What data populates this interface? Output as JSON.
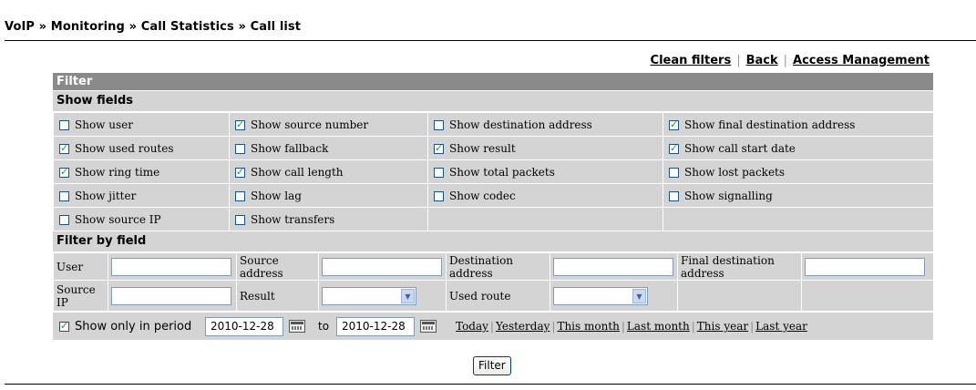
{
  "breadcrumb": "VoIP » Monitoring » Call Statistics » Call list",
  "top_links": [
    "Clean filters",
    "Back",
    "Access Management"
  ],
  "filter_header": "Filter",
  "show_fields_title": "Show fields",
  "show_fields": [
    [
      {
        "label": "Show user",
        "checked": false
      },
      {
        "label": "Show source number",
        "checked": true
      },
      {
        "label": "Show destination address",
        "checked": false
      },
      {
        "label": "Show final destination address",
        "checked": true
      }
    ],
    [
      {
        "label": "Show used routes",
        "checked": true
      },
      {
        "label": "Show fallback",
        "checked": false
      },
      {
        "label": "Show result",
        "checked": true
      },
      {
        "label": "Show call start date",
        "checked": true
      }
    ],
    [
      {
        "label": "Show ring time",
        "checked": true
      },
      {
        "label": "Show call length",
        "checked": true
      },
      {
        "label": "Show total packets",
        "checked": false
      },
      {
        "label": "Show lost packets",
        "checked": false
      }
    ],
    [
      {
        "label": "Show jitter",
        "checked": false
      },
      {
        "label": "Show lag",
        "checked": false
      },
      {
        "label": "Show codec",
        "checked": false
      },
      {
        "label": "Show signalling",
        "checked": false
      }
    ],
    [
      {
        "label": "Show source IP",
        "checked": false
      },
      {
        "label": "Show transfers",
        "checked": false
      },
      null,
      null
    ]
  ],
  "filter_by_field_title": "Filter by field",
  "filter_fields": {
    "user": {
      "label": "User",
      "value": ""
    },
    "source_address": {
      "label": "Source address",
      "value": ""
    },
    "destination_address": {
      "label": "Destination address",
      "value": ""
    },
    "final_destination_address": {
      "label": "Final destination address",
      "value": ""
    },
    "source_ip": {
      "label": "Source IP",
      "value": ""
    },
    "result": {
      "label": "Result",
      "value": ""
    },
    "used_route": {
      "label": "Used route",
      "value": ""
    }
  },
  "period": {
    "checked": true,
    "label": "Show only in period",
    "from": "2010-12-28",
    "to_label": "to",
    "to": "2010-12-28",
    "quick_links": [
      "Today",
      "Yesterday",
      "This month",
      "Last month",
      "This year",
      "Last year"
    ]
  },
  "filter_button": "Filter"
}
